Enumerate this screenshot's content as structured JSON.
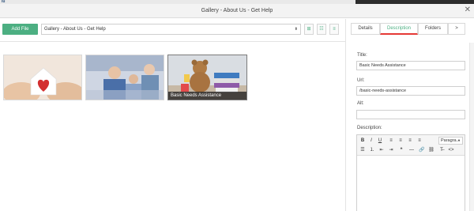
{
  "topbar": {
    "glyph": "ıu"
  },
  "window": {
    "title": "Gallery - About Us - Get Help",
    "close_glyph": "✕"
  },
  "toolbar": {
    "add_file_label": "Add File",
    "folder_value": "Gallery - About Us - Get Help",
    "folder_caret": "⬍",
    "view_icons": [
      "⊞",
      "☷",
      "≡"
    ]
  },
  "gallery": {
    "items": [
      {
        "alt": "hands holding paper house with heart",
        "caption": ""
      },
      {
        "alt": "elderly couple with caregiver",
        "caption": ""
      },
      {
        "alt": "teddy bear with blankets and toys",
        "caption": "Basic Needs Assistance"
      }
    ]
  },
  "tabs": [
    {
      "label": "Details",
      "active": false
    },
    {
      "label": "Description",
      "active": true
    },
    {
      "label": "Folders",
      "active": false
    },
    {
      "label": ">",
      "active": false
    }
  ],
  "details": {
    "title_label": "Title:",
    "title_value": "Basic Needs Assistance",
    "url_label": "Url:",
    "url_value": "/basic-needs-assistance",
    "alt_label": "Alt:",
    "alt_value": "",
    "description_label": "Description:"
  },
  "editor": {
    "row1": [
      "B",
      "I",
      "U",
      "≡",
      "≡",
      "≡",
      "≡"
    ],
    "paragraph_label": "Paragra...",
    "paragraph_caret": "▼",
    "row2": [
      "☰",
      "⒈",
      "⇤",
      "⇥",
      "❝",
      "—",
      "🔗",
      "⛓",
      "T̶",
      "<>"
    ]
  },
  "colors": {
    "accent": "#4caf82",
    "tab_underline": "#e53935"
  }
}
